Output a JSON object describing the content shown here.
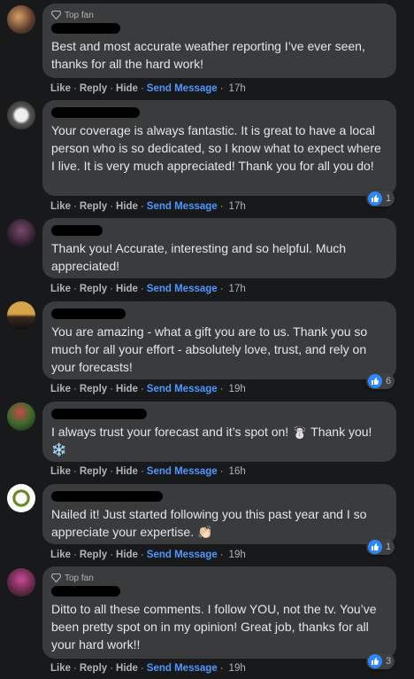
{
  "comments": [
    {
      "top_fan": true,
      "top_fan_label": "Top fan",
      "text": "Best and most accurate weather reporting I’ve ever seen, thanks for all the hard work!",
      "actions": {
        "like": "Like",
        "reply": "Reply",
        "hide": "Hide",
        "send": "Send Message",
        "time": "17h"
      },
      "reactions": null
    },
    {
      "top_fan": false,
      "text": "Your coverage is always fantastic. It is great to have a local person who is so dedicated, so I know what to expect where I live. It is very much appreciated! Thank you for all you do!",
      "actions": {
        "like": "Like",
        "reply": "Reply",
        "hide": "Hide",
        "send": "Send Message",
        "time": "17h"
      },
      "reactions": "1"
    },
    {
      "top_fan": false,
      "text": "Thank you! Accurate, interesting and so helpful. Much appreciated!",
      "actions": {
        "like": "Like",
        "reply": "Reply",
        "hide": "Hide",
        "send": "Send Message",
        "time": "17h"
      },
      "reactions": null
    },
    {
      "top_fan": false,
      "text": "You are amazing - what a gift you are to us. Thank you so much for all your effort - absolutely love, trust, and rely on your forecasts!",
      "actions": {
        "like": "Like",
        "reply": "Reply",
        "hide": "Hide",
        "send": "Send Message",
        "time": "19h"
      },
      "reactions": "6"
    },
    {
      "top_fan": false,
      "text": "I always trust your forecast and it’s spot on! ☃️  Thank you! ❄️",
      "actions": {
        "like": "Like",
        "reply": "Reply",
        "hide": "Hide",
        "send": "Send Message",
        "time": "16h"
      },
      "reactions": null
    },
    {
      "top_fan": false,
      "text": "Nailed it! Just started following you this past year and I so appreciate your expertise. 👏🏻",
      "actions": {
        "like": "Like",
        "reply": "Reply",
        "hide": "Hide",
        "send": "Send Message",
        "time": "19h"
      },
      "reactions": "1"
    },
    {
      "top_fan": true,
      "top_fan_label": "Top fan",
      "text": "Ditto to all these comments. I follow YOU, not the tv. You’ve been pretty spot on in my opinion! Great job, thanks for all your hard work!!",
      "actions": {
        "like": "Like",
        "reply": "Reply",
        "hide": "Hide",
        "send": "Send Message",
        "time": "19h"
      },
      "reactions": "3"
    }
  ],
  "colors": {
    "background": "#18191a",
    "bubble": "#3a3b3c",
    "text": "#e4e6eb",
    "muted": "#b0b3b8",
    "link": "#4e97ff",
    "like": "#2d88ff"
  },
  "icons": {
    "top_fan": "diamond-badge-icon",
    "reaction": "thumbs-up-icon"
  }
}
